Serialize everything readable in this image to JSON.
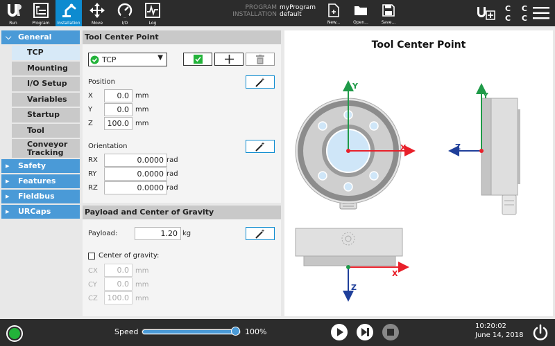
{
  "nav": {
    "run": "Run",
    "program": "Program",
    "installation": "Installation",
    "move": "Move",
    "io": "I/O",
    "log": "Log"
  },
  "program_info": {
    "program_key": "PROGRAM",
    "program_value": "myProgram",
    "installation_key": "INSTALLATION",
    "installation_value": "default"
  },
  "file_buttons": {
    "new": "New...",
    "open": "Open...",
    "save": "Save..."
  },
  "cc_indicator": "C C",
  "sidebar": {
    "sections": [
      {
        "label": "General",
        "expanded": true
      },
      {
        "label": "Safety",
        "expanded": false
      },
      {
        "label": "Features",
        "expanded": false
      },
      {
        "label": "Fieldbus",
        "expanded": false
      },
      {
        "label": "URCaps",
        "expanded": false
      }
    ],
    "general_items": [
      "TCP",
      "Mounting",
      "I/O Setup",
      "Variables",
      "Startup",
      "Tool",
      "Conveyor Tracking"
    ],
    "active_item": "TCP"
  },
  "tcp_panel": {
    "title": "Tool Center Point",
    "selected_tcp": "TCP",
    "position_label": "Position",
    "position": [
      {
        "axis": "X",
        "value": "0.0",
        "unit": "mm"
      },
      {
        "axis": "Y",
        "value": "0.0",
        "unit": "mm"
      },
      {
        "axis": "Z",
        "value": "100.0",
        "unit": "mm"
      }
    ],
    "orientation_label": "Orientation",
    "orientation": [
      {
        "axis": "RX",
        "value": "0.0000",
        "unit": "rad"
      },
      {
        "axis": "RY",
        "value": "0.0000",
        "unit": "rad"
      },
      {
        "axis": "RZ",
        "value": "0.0000",
        "unit": "rad"
      }
    ]
  },
  "payload_panel": {
    "title": "Payload and Center of Gravity",
    "payload_label": "Payload:",
    "payload_value": "1.20",
    "payload_unit": "kg",
    "cog_label": "Center of gravity:",
    "cog_checked": false,
    "cog": [
      {
        "axis": "CX",
        "value": "0.0",
        "unit": "mm"
      },
      {
        "axis": "CY",
        "value": "0.0",
        "unit": "mm"
      },
      {
        "axis": "CZ",
        "value": "100.0",
        "unit": "mm"
      }
    ]
  },
  "diagram": {
    "title": "Tool Center Point",
    "axis_x": "X",
    "axis_y": "Y",
    "axis_z": "Z"
  },
  "bottom": {
    "speed_label": "Speed",
    "speed_value": "100%",
    "speed_fraction": 1.0,
    "time": "10:20:02",
    "date": "June 14, 2018"
  },
  "colors": {
    "accent": "#0d8bd0",
    "nav_blue": "#4a9ad7",
    "x_axis": "#e8202a",
    "y_axis": "#1f9a48",
    "z_axis": "#1f3f9a",
    "power": "#23b33a"
  }
}
